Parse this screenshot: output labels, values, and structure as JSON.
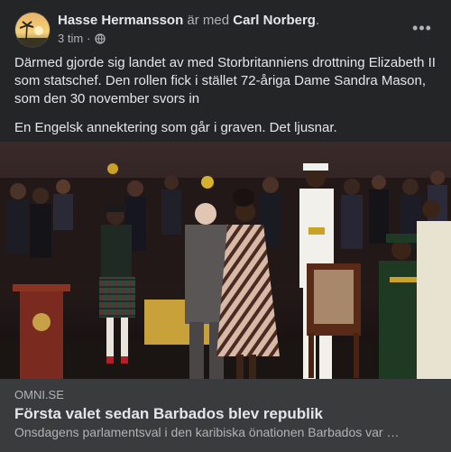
{
  "post": {
    "author": "Hasse Hermansson",
    "with_text": "är med",
    "tagged": "Carl Norberg",
    "tagged_suffix": ".",
    "time": "3 tim",
    "separator": "·",
    "privacy_icon": "globe-icon",
    "more_icon": "more-options-icon",
    "more_label": "•••",
    "paragraph1": "Därmed gjorde sig landet av med Storbritanniens drottning Elizabeth II som statschef. Den rollen fick i stället 72-åriga Dame Sandra Mason, som den 30 november svors in",
    "paragraph2": "En Engelsk annektering som går i graven. Det ljusnar."
  },
  "link_preview": {
    "domain": "OMNI.SE",
    "title": "Första valet sedan Barbados blev republik",
    "description": "Onsdagens parlamentsval i den karibiska önationen Barbados var …"
  },
  "colors": {
    "card_bg": "#242526",
    "link_bg": "#3a3b3c",
    "primary_text": "#e4e6eb",
    "secondary_text": "#b0b3b8"
  }
}
